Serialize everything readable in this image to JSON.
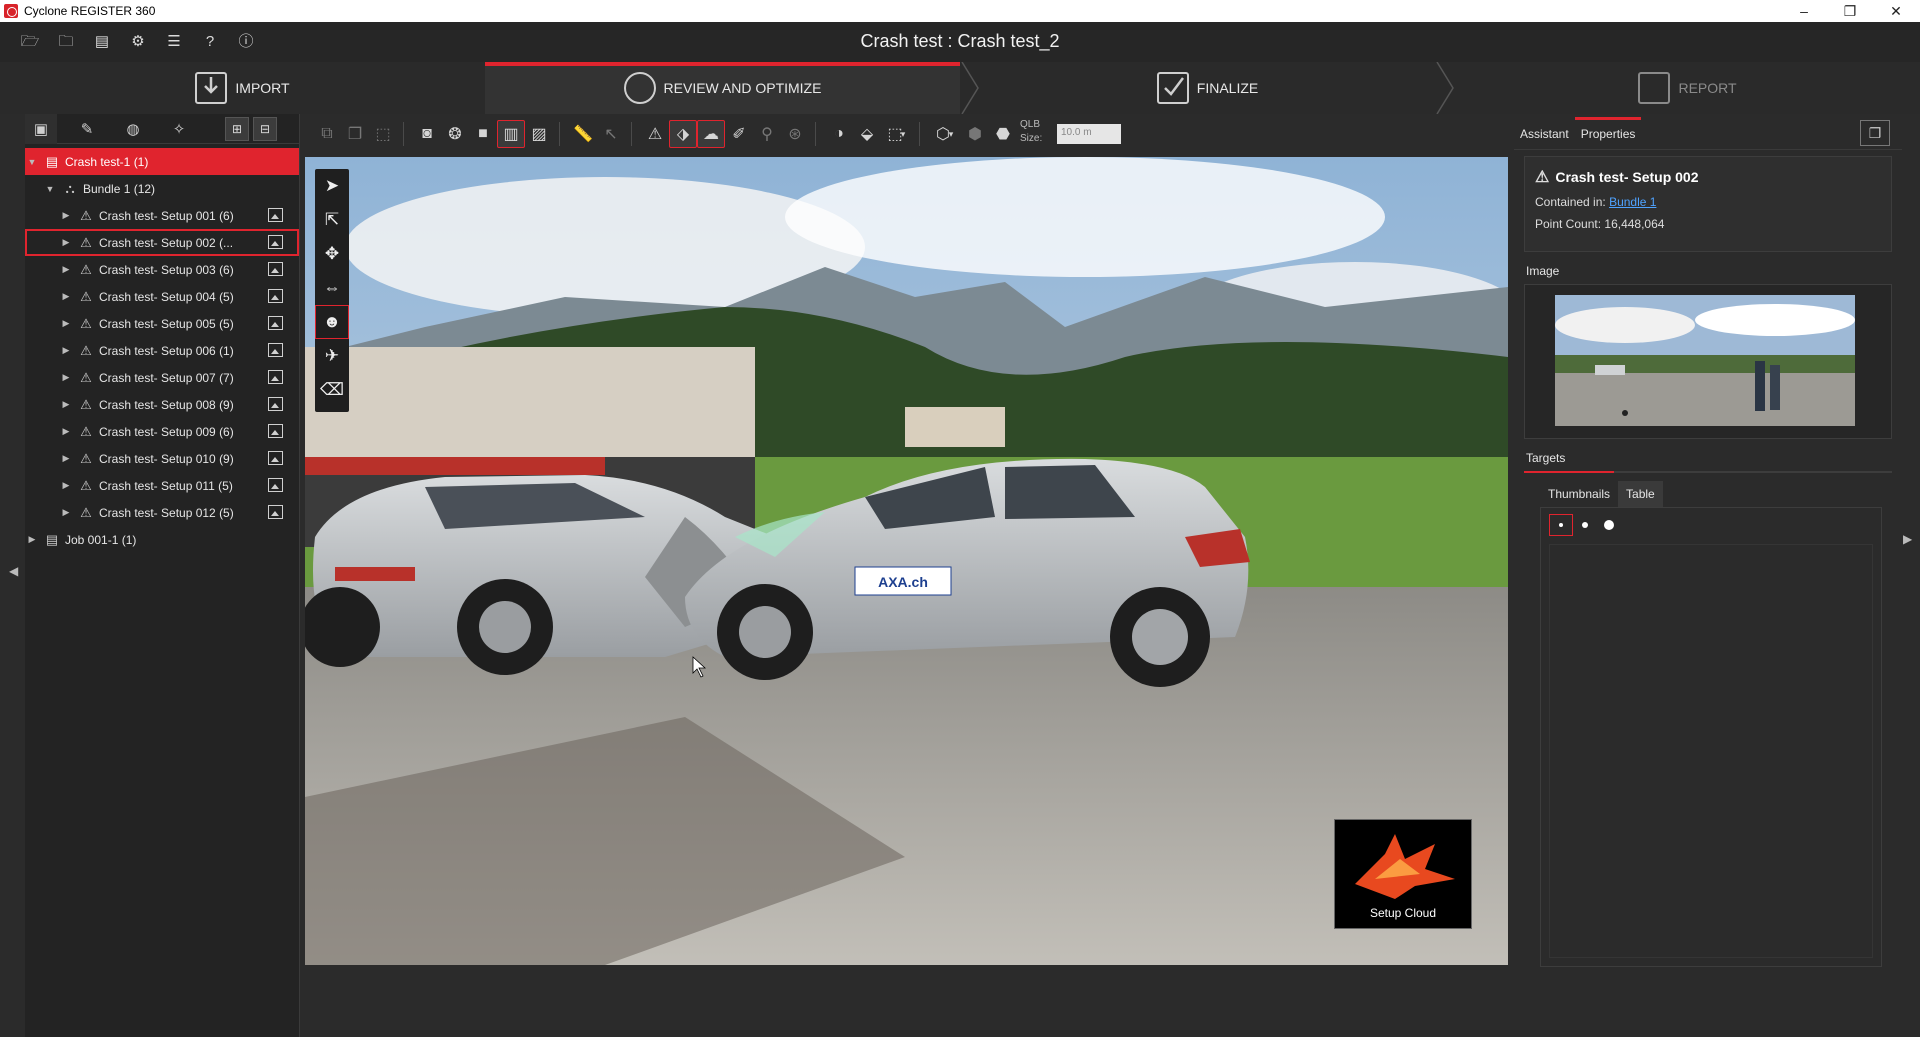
{
  "window": {
    "app_title": "Cyclone REGISTER 360",
    "minimize": "–",
    "maximize": "❐",
    "close": "✕"
  },
  "header": {
    "project_title": "Crash test : Crash test_2",
    "icons": [
      "open-folder-icon",
      "save-icon",
      "layers-icon",
      "settings-icon",
      "database-icon",
      "help-icon",
      "info-icon"
    ]
  },
  "workflow": {
    "steps": [
      {
        "label": "IMPORT",
        "state": "normal"
      },
      {
        "label": "REVIEW AND OPTIMIZE",
        "state": "active"
      },
      {
        "label": "FINALIZE",
        "state": "normal"
      },
      {
        "label": "REPORT",
        "state": "disabled"
      }
    ]
  },
  "tree": {
    "root": "Crash test-1 (1)",
    "bundle": "Bundle 1 (12)",
    "setups": [
      "Crash test- Setup 001 (6)",
      "Crash test- Setup 002 (...",
      "Crash test- Setup 003 (6)",
      "Crash test- Setup 004 (5)",
      "Crash test- Setup 005 (5)",
      "Crash test- Setup 006 (1)",
      "Crash test- Setup 007 (7)",
      "Crash test- Setup 008 (9)",
      "Crash test- Setup 009 (6)",
      "Crash test- Setup 010 (9)",
      "Crash test- Setup 011 (5)",
      "Crash test- Setup 012 (5)"
    ],
    "selected_index": 1,
    "job": "Job 001-1 (1)"
  },
  "toolbar": {
    "qlb_label_1": "QLB",
    "qlb_label_2": "Size:",
    "qlb_size": "10.0 m"
  },
  "viewport": {
    "overlay_label": "Setup Cloud",
    "car_sign": "AXA.ch"
  },
  "properties": {
    "tabs": [
      "Assistant",
      "Properties"
    ],
    "active_tab": "Properties",
    "title": "Crash test- Setup 002",
    "contained_in_label": "Contained in:",
    "contained_in_value": "Bundle 1",
    "point_count_label": "Point Count:",
    "point_count_value": "16,448,064",
    "image_header": "Image",
    "targets_header": "Targets",
    "target_tabs": [
      "Thumbnails",
      "Table"
    ]
  },
  "colors": {
    "accent": "#e0242e",
    "panel": "#232323",
    "background": "#2b2b2b",
    "link": "#4fa3ff"
  }
}
